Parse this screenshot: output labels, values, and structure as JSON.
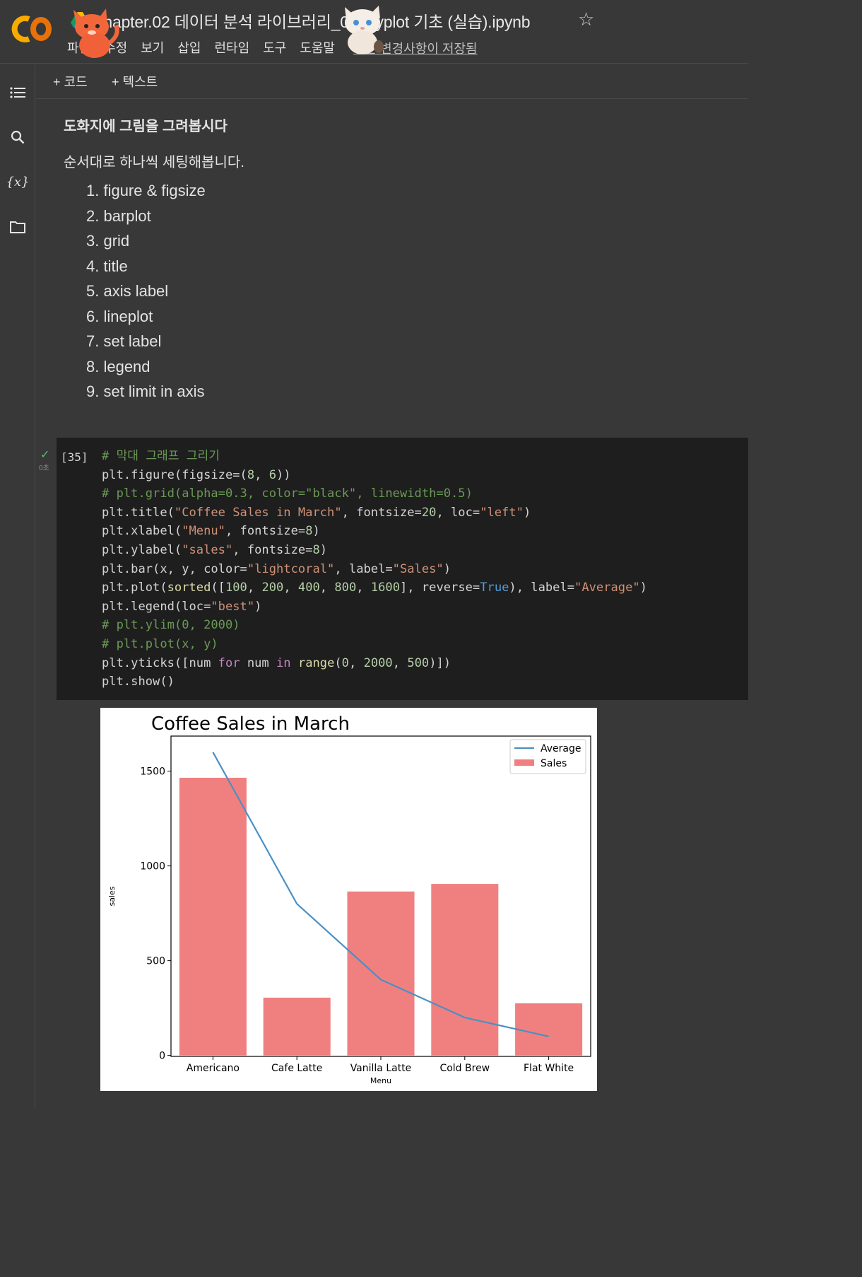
{
  "header": {
    "title": "Chapter.02 데이터 분석 라이브러리_08. pyplot 기초 (실습).ipynb",
    "menu": [
      "파일",
      "수정",
      "보기",
      "삽입",
      "런타임",
      "도구",
      "도움말"
    ],
    "save_status": "모든 변경사항이 저장됨"
  },
  "sidebar": {
    "icons": [
      "toc-icon",
      "search-icon",
      "variables-icon",
      "folder-icon"
    ]
  },
  "toolbar": {
    "add_code": "+ 코드",
    "add_text": "+ 텍스트"
  },
  "text_cell": {
    "heading": "도화지에 그림을 그려봅시다",
    "intro": "순서대로 하나씩 세팅해봅니다.",
    "steps": [
      "1. figure & figsize",
      "2. barplot",
      "3. grid",
      "4. title",
      "5. axis label",
      "6. lineplot",
      "7. set label",
      "8. legend",
      "9. set limit in axis"
    ]
  },
  "code_cell": {
    "exec_count": "[35]",
    "exec_time": "0초",
    "lines": [
      "# 막대 그래프 그리기",
      "plt.figure(figsize=(8, 6))",
      "# plt.grid(alpha=0.3, color=\"black\", linewidth=0.5)",
      "plt.title(\"Coffee Sales in March\", fontsize=20, loc=\"left\")",
      "plt.xlabel(\"Menu\", fontsize=8)",
      "plt.ylabel(\"sales\", fontsize=8)",
      "plt.bar(x, y, color=\"lightcoral\", label=\"Sales\")",
      "plt.plot(sorted([100, 200, 400, 800, 1600], reverse=True), label=\"Average\")",
      "plt.legend(loc=\"best\")",
      "# plt.ylim(0, 2000)",
      "# plt.plot(x, y)",
      "plt.yticks([num for num in range(0, 2000, 500)])",
      "plt.show()"
    ]
  },
  "chart_data": {
    "type": "bar",
    "title": "Coffee Sales in March",
    "xlabel": "Menu",
    "ylabel": "sales",
    "categories": [
      "Americano",
      "Cafe Latte",
      "Vanilla Latte",
      "Cold Brew",
      "Flat White"
    ],
    "series": [
      {
        "name": "Sales",
        "type": "bar",
        "color": "#f08080",
        "values": [
          1465,
          305,
          865,
          905,
          275
        ]
      },
      {
        "name": "Average",
        "type": "line",
        "color": "#4a90c4",
        "values": [
          1600,
          800,
          400,
          200,
          100
        ]
      }
    ],
    "yticks": [
      0,
      500,
      1000,
      1500
    ],
    "ylim": [
      -5,
      1685
    ],
    "legend": "top-right",
    "grid": false
  }
}
